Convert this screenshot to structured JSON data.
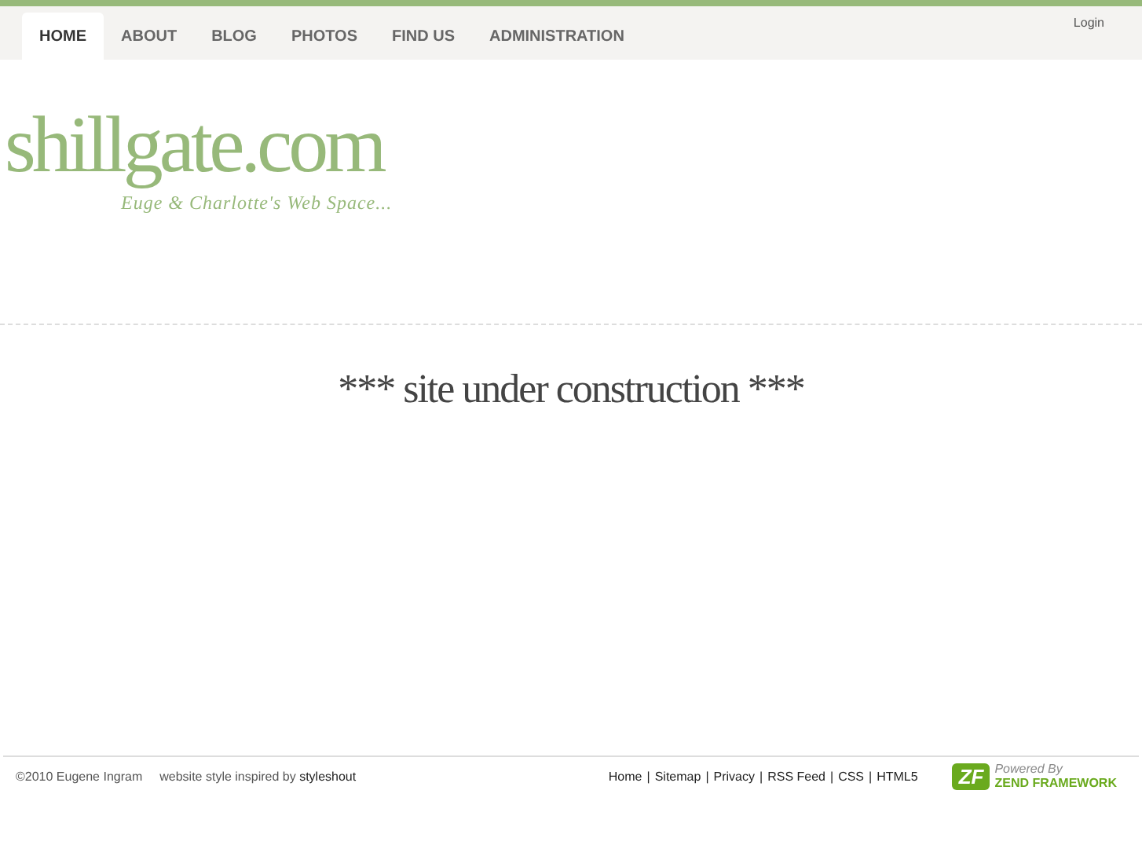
{
  "nav": {
    "tabs": [
      {
        "label": "HOME",
        "selected": true
      },
      {
        "label": "ABOUT",
        "selected": false
      },
      {
        "label": "BLOG",
        "selected": false
      },
      {
        "label": "PHOTOS",
        "selected": false
      },
      {
        "label": "FIND US",
        "selected": false
      },
      {
        "label": "ADMINISTRATION",
        "selected": false
      }
    ],
    "login": "Login"
  },
  "header": {
    "logo": "shillgate.com",
    "tagline": "Euge & Charlotte's Web Space..."
  },
  "main": {
    "message": "*** site under construction ***"
  },
  "footer": {
    "copyright": "©2010 Eugene Ingram",
    "credit_prefix": "website style inspired by",
    "credit_link": "styleshout",
    "separator": "|",
    "links": [
      "Home",
      "Sitemap",
      "Privacy",
      "RSS Feed",
      "CSS",
      "HTML5"
    ],
    "badge": {
      "mark": "ZF",
      "line1": "Powered By",
      "line2": "ZEND FRAMEWORK"
    }
  }
}
